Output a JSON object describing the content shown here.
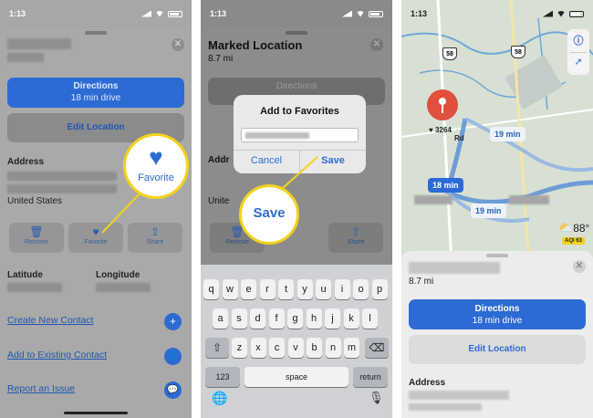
{
  "status": {
    "time": "1:13"
  },
  "panel1": {
    "directions": {
      "title": "Directions",
      "subtitle": "18 min drive"
    },
    "edit_location": "Edit Location",
    "address_label": "Address",
    "country": "United States",
    "actions": [
      {
        "label": "Remove",
        "icon": "trash-icon"
      },
      {
        "label": "Favorite",
        "icon": "heart-icon"
      },
      {
        "label": "Share",
        "icon": "share-icon"
      }
    ],
    "favorite_callout": "Favorite",
    "latitude_label": "Latitude",
    "longitude_label": "Longitude",
    "links": [
      "Create New Contact",
      "Add to Existing Contact",
      "Report an Issue"
    ]
  },
  "panel2": {
    "title": "Marked Location",
    "distance": "8.7 mi",
    "directions_label": "Directions",
    "dialog": {
      "title": "Add to Favorites",
      "cancel": "Cancel",
      "save": "Save"
    },
    "save_callout": "Save",
    "actions": [
      "Remove",
      "Favorite",
      "Share"
    ],
    "keyboard": {
      "row1": [
        "q",
        "w",
        "e",
        "r",
        "t",
        "y",
        "u",
        "i",
        "o",
        "p"
      ],
      "row2": [
        "a",
        "s",
        "d",
        "f",
        "g",
        "h",
        "j",
        "k",
        "l"
      ],
      "row3": [
        "z",
        "x",
        "c",
        "v",
        "b",
        "n",
        "m"
      ],
      "numbers": "123",
      "space": "space",
      "return": "return"
    }
  },
  "panel3": {
    "road_shields": [
      "58",
      "58"
    ],
    "pin_label": "3264",
    "pin_sublabel": "Rd",
    "route_times": [
      "19 min",
      "18 min",
      "19 min"
    ],
    "weather": {
      "temp": "88°",
      "aqi": "AQI 63"
    },
    "distance": "8.7 mi",
    "directions": {
      "title": "Directions",
      "subtitle": "18 min drive"
    },
    "edit_location": "Edit Location",
    "address_label": "Address"
  },
  "colors": {
    "accent": "#2c6bd4",
    "highlight": "#f3d21c",
    "pin": "#e0503c"
  }
}
